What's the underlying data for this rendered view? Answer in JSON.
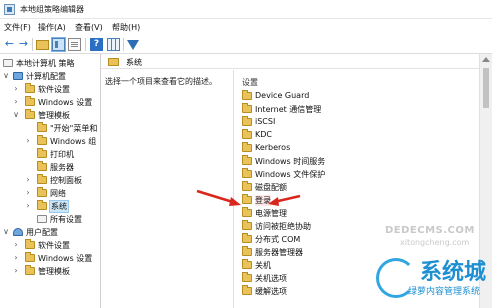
{
  "window": {
    "title": "本地组策略编辑器"
  },
  "menu": {
    "items": [
      "文件(F)",
      "操作(A)",
      "查看(V)",
      "帮助(H)"
    ]
  },
  "toolbar": {
    "icons": [
      "back-arrow-icon",
      "forward-arrow-icon",
      "up-folder-icon",
      "show-hide-tree-icon",
      "properties-icon",
      "help-icon",
      "view-icon",
      "filter-icon"
    ]
  },
  "tree": {
    "root": "本地计算机 策略",
    "computer_config": "计算机配置",
    "cc_software": "软件设置",
    "cc_windows": "Windows 设置",
    "cc_admin": "管理模板",
    "start_menu": "\"开始\"菜单和",
    "windows_components": "Windows 组",
    "printers": "打印机",
    "servers": "服务器",
    "control_panel": "控制面板",
    "network": "网络",
    "system": "系统",
    "all_settings": "所有设置",
    "user_config": "用户配置",
    "uc_software": "软件设置",
    "uc_windows": "Windows 设置",
    "uc_admin": "管理模板"
  },
  "content": {
    "header_title": "系统",
    "description": "选择一个项目来查看它的描述。",
    "column_header": "设置",
    "items": [
      "Device Guard",
      "Internet 通信管理",
      "iSCSI",
      "KDC",
      "Kerberos",
      "Windows 时间服务",
      "Windows 文件保护",
      "磁盘配额",
      "登录",
      "电源管理",
      "访问被拒绝协助",
      "分布式 COM",
      "服务器管理器",
      "关机",
      "关机选项",
      "缓解选项"
    ]
  },
  "watermark": {
    "brand": "系统城",
    "slogan": "绿萝内容管理系统",
    "dede": "DEDECMS.COM",
    "site": "xitongcheng.com"
  },
  "colors": {
    "arrow": "#d9271d",
    "selection": "#cde6f7",
    "folder": "#e9c35a"
  }
}
